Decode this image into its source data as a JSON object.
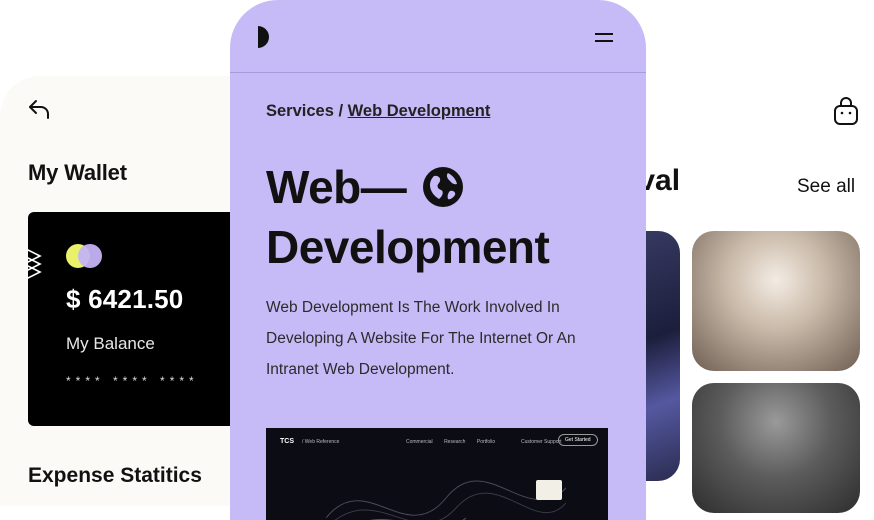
{
  "wallet": {
    "title": "My Wallet",
    "card": {
      "amount": "$ 6421.50",
      "label": "My Balance",
      "number_masked": "****  ****  ****"
    },
    "section_title": "Expense Statitics",
    "icons": {
      "back": "back-arrow-icon"
    },
    "colors": {
      "card_bg": "#000000",
      "dot_yellow": "#e9f06a",
      "dot_purple": "#c4b4f4"
    }
  },
  "web": {
    "breadcrumb": {
      "parent": "Services /",
      "current": "Web Development"
    },
    "headline": {
      "line1": "Web—",
      "line2": "Development"
    },
    "description": "Web Development Is The Work Involved In Developing A Website For The Internet Or An Intranet Web Development.",
    "preview": {
      "brand": "TCS",
      "tag": "/ Web Reference",
      "nav": [
        "Commercial",
        "Research",
        "Portfolio"
      ],
      "support": "Customer Support",
      "button": "Get Started"
    },
    "icons": {
      "brand": "half-circle-logo-icon",
      "menu": "hamburger-menu-icon",
      "globe": "globe-icon"
    },
    "colors": {
      "card_bg": "#c6bbf7"
    }
  },
  "shop": {
    "title_partial": "ival",
    "see_all": "See all",
    "icons": {
      "bag": "shopping-bag-icon"
    }
  }
}
